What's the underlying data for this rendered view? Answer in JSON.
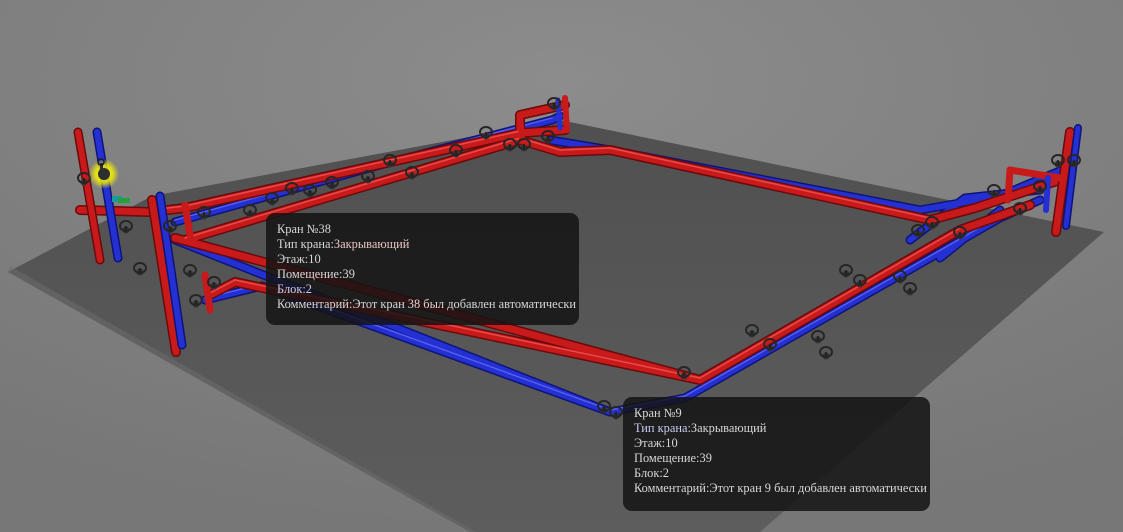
{
  "colors": {
    "background": "#808080",
    "floor": "#5a5a5a",
    "hot_pipe": "#c01818",
    "cold_pipe": "#1a22c0",
    "valve": "#2e2e2e",
    "selected_highlight": "#f4f000",
    "tooltip_bg": "#141414",
    "tooltip_text": "#d7d7d7"
  },
  "selected_valve": {
    "icon": "valve-icon",
    "state": "highlighted"
  },
  "tooltips": [
    {
      "id": "tip-38",
      "title": "Кран №38",
      "type_label": "Тип крана:",
      "type_value": "Закрывающий",
      "floor_label": "Этаж:",
      "floor_value": "10",
      "room_label": "Помещение:",
      "room_value": "39",
      "block_label": "Блок:",
      "block_value": "2",
      "comment_label": "Комментарий:",
      "comment_value": "Этот кран 38 был добавлен автоматически"
    },
    {
      "id": "tip-9",
      "title": "Кран №9",
      "type_label": "Тип крана:",
      "type_value": "Закрывающий",
      "floor_label": "Этаж:",
      "floor_value": "10",
      "room_label": "Помещение:",
      "room_value": "39",
      "block_label": "Блок:",
      "block_value": "2",
      "comment_label": "Комментарий:",
      "comment_value": "Этот кран 9 был добавлен автоматически"
    }
  ]
}
